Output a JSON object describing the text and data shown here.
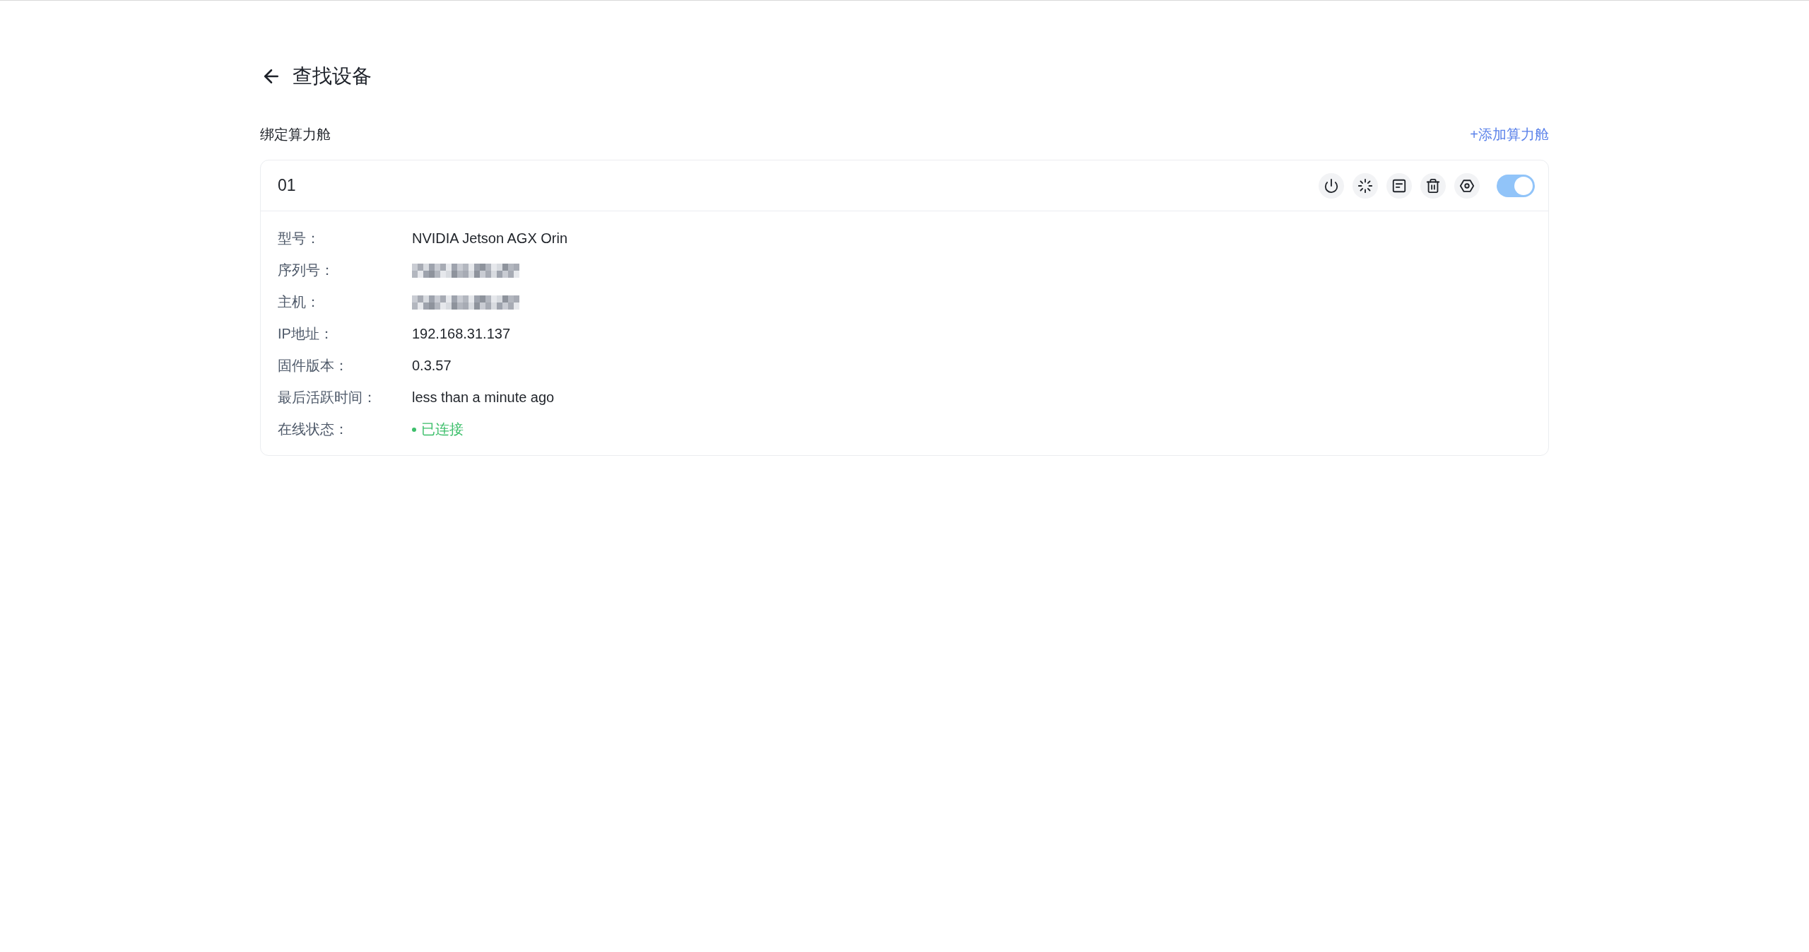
{
  "page": {
    "title": "查找设备"
  },
  "section": {
    "title": "绑定算力舱",
    "add_link": "+添加算力舱"
  },
  "devices": [
    {
      "name": "01",
      "enabled": true,
      "fields": [
        {
          "kind": "text",
          "label": "型号：",
          "value": "NVIDIA Jetson AGX Orin"
        },
        {
          "kind": "redacted",
          "label": "序列号："
        },
        {
          "kind": "redacted",
          "label": "主机："
        },
        {
          "kind": "text",
          "label": "IP地址：",
          "value": "192.168.31.137"
        },
        {
          "kind": "text",
          "label": "固件版本：",
          "value": "0.3.57"
        },
        {
          "kind": "text",
          "label": "最后活跃时间：",
          "value": "less than a minute ago"
        },
        {
          "kind": "status",
          "label": "在线状态：",
          "value": "已连接",
          "online": true
        }
      ]
    }
  ]
}
